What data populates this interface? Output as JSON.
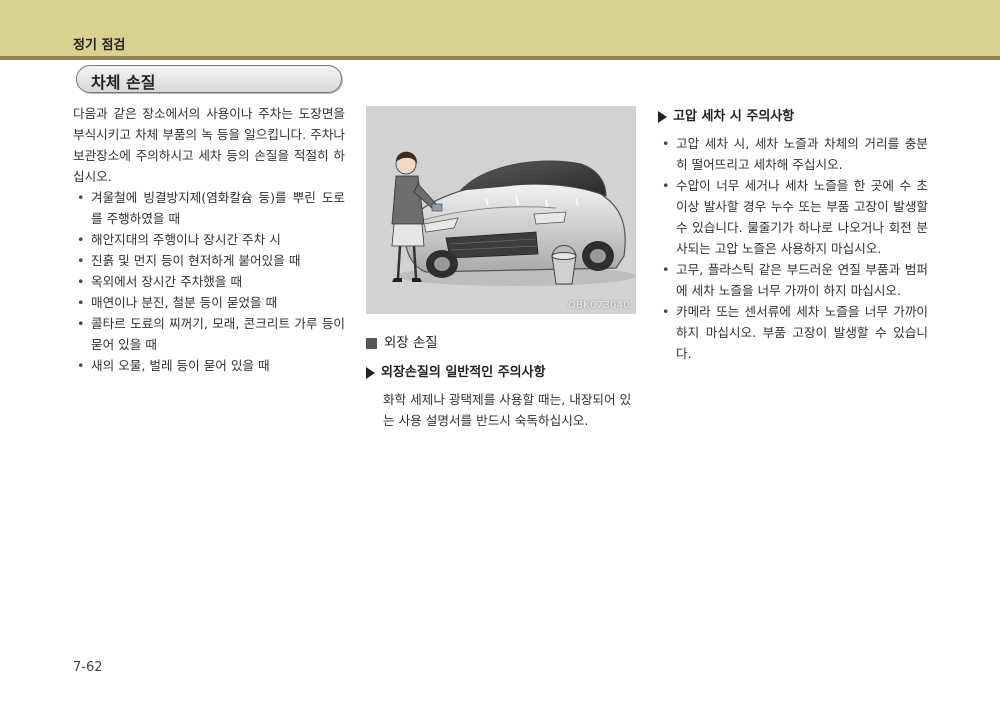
{
  "header": {
    "title": "정기 점검",
    "bar_color": "#d9d18e",
    "line_color": "#8c8450"
  },
  "section": {
    "title": "차체 손질"
  },
  "left": {
    "intro": "다음과 같은 장소에서의 사용이나 주차는 도장면을 부식시키고 차체 부품의 녹 등을 일으킵니다. 주차나 보관장소에 주의하시고 세차 등의 손질을 적절히 하십시오.",
    "bullets": [
      "겨울철에 빙결방지제(염화칼슘 등)를 뿌린 도로를 주행하였을 때",
      "해안지대의 주행이나 장시간 주차 시",
      "진흙 및 먼지 등이 현저하게 붙어있을 때",
      "옥외에서 장시간 주차했을 때",
      "매연이나 분진, 철분 등이 묻었을 때",
      "콜타르 도료의 찌꺼기, 모래, 콘크리트 가루 등이 묻어 있을 때",
      "새의 오물, 벌레 등이 묻어 있을 때"
    ]
  },
  "figure": {
    "code": "OBK073040"
  },
  "middle": {
    "heading": "외장 손질",
    "subheading": "외장손질의 일반적인 주의사항",
    "body": "화학 세제나 광택제를 사용할 때는, 내장되어 있는 사용 설명서를 반드시 숙독하십시오."
  },
  "right": {
    "subheading": "고압 세차 시 주의사항",
    "bullets": [
      "고압 세차 시, 세차 노즐과 차체의 거리를 충분히 떨어뜨리고 세차해 주십시오.",
      "수압이 너무 세거나 세차 노즐을 한 곳에 수 초 이상 발사할 경우 누수 또는 부품 고장이 발생할 수 있습니다. 물줄기가 하나로 나오거나 회전 분사되는 고압 노즐은 사용하지 마십시오.",
      "고무, 플라스틱 같은 부드러운 연질 부품과 범퍼에 세차 노즐을 너무 가까이 하지 마십시오.",
      "카메라 또는 센서류에 세차 노즐을 너무 가까이 하지 마십시오. 부품 고장이 발생할 수 있습니다."
    ]
  },
  "footer": {
    "page_number": "7-62"
  }
}
